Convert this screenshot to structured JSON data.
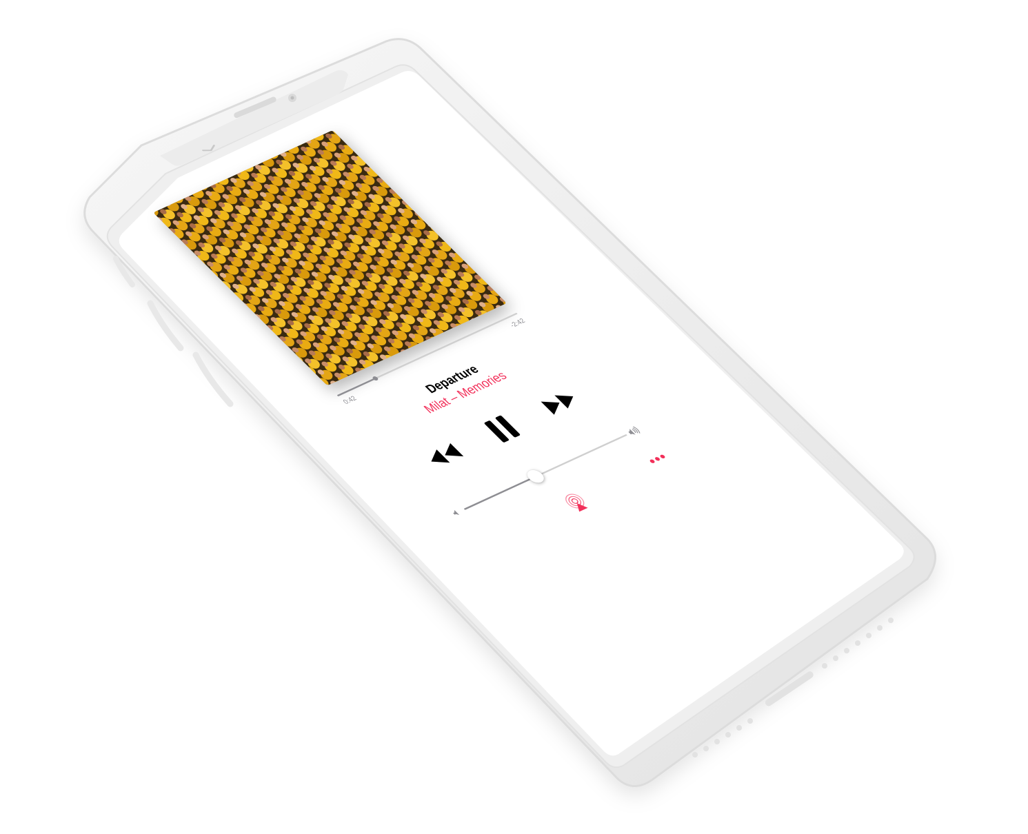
{
  "player": {
    "track_title": "Departure",
    "artist_album": "Milat – Memories",
    "elapsed_time": "0:42",
    "remaining_time": "-2:42",
    "progress_fraction": 0.21,
    "volume_fraction": 0.44
  },
  "icons": {
    "collapse": "chevron-down-icon",
    "rewind": "rewind-icon",
    "pause": "pause-icon",
    "forward": "fast-forward-icon",
    "volume_low": "speaker-low-icon",
    "volume_high": "speaker-high-icon",
    "airplay": "airplay-icon",
    "more": "more-icon"
  },
  "colors": {
    "accent": "#f2305a",
    "text_primary": "#000000",
    "secondary": "#8e8e93",
    "album_yellow": "#e9ab13"
  }
}
